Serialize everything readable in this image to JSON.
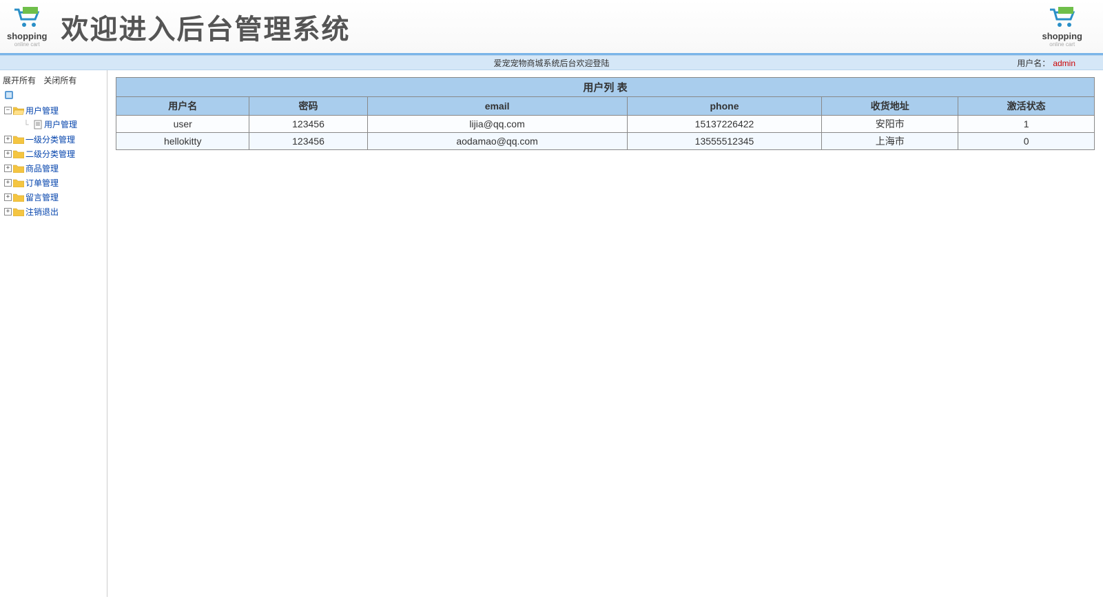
{
  "header": {
    "title": "欢迎进入后台管理系统",
    "logo_text": "shopping",
    "logo_sub": "online cart"
  },
  "topbar": {
    "center": "爱宠宠物商城系统后台欢迎登陆",
    "user_label": "用户名：",
    "user_name": "admin"
  },
  "sidebar": {
    "expand_all": "展开所有",
    "collapse_all": "关闭所有",
    "nodes": [
      {
        "label": "用户管理",
        "expanded": true,
        "children": [
          {
            "label": "用户管理"
          }
        ]
      },
      {
        "label": "一级分类管理",
        "expanded": false
      },
      {
        "label": "二级分类管理",
        "expanded": false
      },
      {
        "label": "商品管理",
        "expanded": false
      },
      {
        "label": "订单管理",
        "expanded": false
      },
      {
        "label": "留言管理",
        "expanded": false
      },
      {
        "label": "注销退出",
        "expanded": false
      }
    ]
  },
  "main": {
    "table_title": "用户列 表",
    "columns": [
      "用户名",
      "密码",
      "email",
      "phone",
      "收货地址",
      "激活状态"
    ],
    "rows": [
      {
        "username": "user",
        "password": "123456",
        "email": "lijia@qq.com",
        "phone": "15137226422",
        "address": "安阳市",
        "active": "1"
      },
      {
        "username": "hellokitty",
        "password": "123456",
        "email": "aodamao@qq.com",
        "phone": "13555512345",
        "address": "上海市",
        "active": "0"
      }
    ]
  }
}
